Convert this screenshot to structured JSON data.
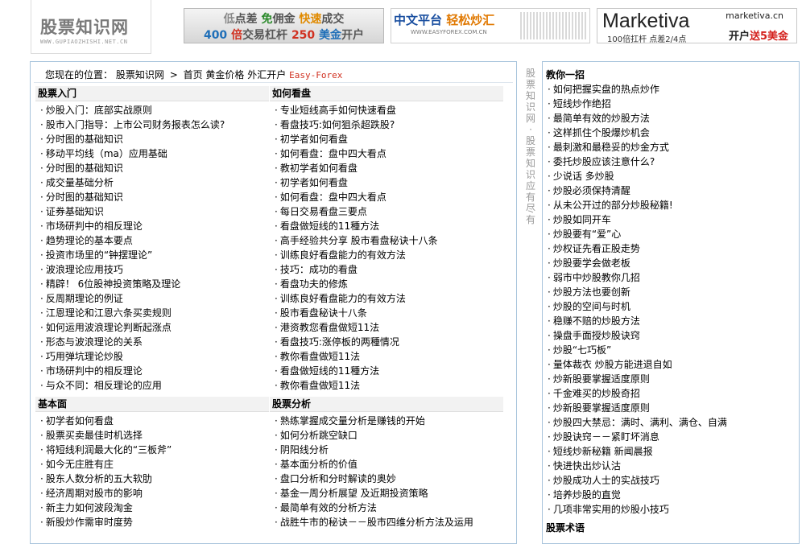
{
  "logo": {
    "text": "股票知识网",
    "sub": "WWW.GUPIAOZHISHI.NET.CN"
  },
  "banners": {
    "b1": {
      "a": "低",
      "b": "点差",
      "c": "免",
      "d": "佣金",
      "e": "快速",
      "f": "成交",
      "g": "400",
      "h": "倍",
      "i": "交易杠杆",
      "j": "250",
      "k": "美金",
      "l": "开户"
    },
    "b2": {
      "t1": "中文平台",
      "t2": "轻松炒汇",
      "url": "WWW.EASYFOREX.COM.CN"
    },
    "b3": {
      "brand": "Marketiva",
      "site": "marketiva.cn",
      "sub": "100倍扛杆  点差2/4点",
      "promo1": "开户",
      "promo2": "送5美金"
    }
  },
  "breadcrumb": {
    "prefix": "您现在的位置：",
    "site": "股票知识网",
    "sep": ">",
    "home": "首页",
    "gold": "黄金价格",
    "fx": "外汇开户",
    "easy": "Easy-Forex"
  },
  "sections": {
    "rumen": {
      "title": "股票入门",
      "items": [
        "炒股入门：底部实战原则",
        "股市入门指导：上市公司财务报表怎么读?",
        "分时图的基础知识",
        "移动平均线（ma）应用基础",
        "分时图的基础知识",
        "成交量基础分析",
        "分时图的基础知识",
        "证券基础知识",
        "市场研判中的相反理论",
        "趋势理论的基本要点",
        "投资市场里的“钟摆理论”",
        "波浪理论应用技巧",
        "精辟！ 6位股神投资策略及理论",
        "反周期理论的例证",
        "江恩理论和江恩六条买卖规则",
        "如何运用波浪理论判断起涨点",
        "形态与波浪理论的关系",
        "巧用弹坑理论炒股",
        "市场研判中的相反理论",
        "与众不同：相反理论的应用"
      ]
    },
    "kanpan": {
      "title": "如何看盘",
      "items": [
        "专业短线高手如何快速看盘",
        "看盘技巧:如何狙杀超跌股?",
        "初学者如何看盘",
        "如何看盘：盘中四大看点",
        "教初学者如何看盘",
        "初学者如何看盘",
        "如何看盘：盘中四大看点",
        "每日交易看盘三要点",
        "看盘做短线的11種方法",
        "高手经验共分享 股市看盘秘诀十八条",
        "训练良好看盘能力的有效方法",
        "技巧：成功的看盘",
        "看盘功夫的修炼",
        "训练良好看盘能力的有效方法",
        "股市看盘秘诀十八条",
        "港资教您看盘做短11法",
        "看盘技巧:涨停板的两種情况",
        "教你看盘做短11法",
        "看盘做短线的11種方法",
        "教你看盘做短11法"
      ]
    },
    "jibenmian": {
      "title": "基本面",
      "items": [
        "初学者如何看盘",
        "股票买卖最佳时机选择",
        "将短线利润最大化的“三板斧”",
        "如今无庄胜有庄",
        "股东人数分析的五大软肋",
        "经济周期对股市的影响",
        "新主力如何波段淘金",
        "新股炒作需审时度势"
      ]
    },
    "fenxi": {
      "title": "股票分析",
      "items": [
        "熟练掌握成交量分析是赚钱的开始",
        "如何分析跳空缺口",
        "阴阳线分析",
        "基本面分析的价值",
        "盘口分析和分时解读的奥妙",
        "基金一周分析展望 及近期投资策略",
        "最简单有效的分析方法",
        "战胜牛市的秘诀－－股市四维分析方法及运用"
      ]
    }
  },
  "vertical": "股票知识网·股票知识应有尽有",
  "sidebar": {
    "title": "教你一招",
    "items": [
      "如何把握实盘的热点炒作",
      "短线炒作绝招",
      "最简单有效的炒股方法",
      "这样抓住个股爆炒机会",
      "最刺激和最稳妥的炒金方式",
      "委托炒股应该注意什么?",
      "少说话 多炒股",
      "炒股必须保持清醒",
      "从未公开过的部分炒股秘籍!",
      "炒股如同开车",
      "炒股要有“爱”心",
      "炒权证先看正股走势",
      "炒股要学会做老板",
      "弱市中炒股教你几招",
      "炒股方法也要创新",
      "炒股的空间与时机",
      "稳赚不赔的炒股方法",
      "操盘手面授炒股诀窍",
      "炒股“七巧板”",
      "量体裁衣 炒股方能进退自如",
      "炒新股要掌握适度原则",
      "千金难买的炒股奇招",
      "炒新股要掌握适度原则",
      "炒股四大禁忌：满时、满利、满仓、自满",
      "炒股诀窍－－紧盯坏消息",
      "短线炒新秘籍 新闻晨报",
      "快进快出炒认沽",
      "炒股成功人士的实战技巧",
      "培养炒股的直觉",
      "几项非常实用的炒股小技巧"
    ],
    "next_title": "股票术语"
  }
}
